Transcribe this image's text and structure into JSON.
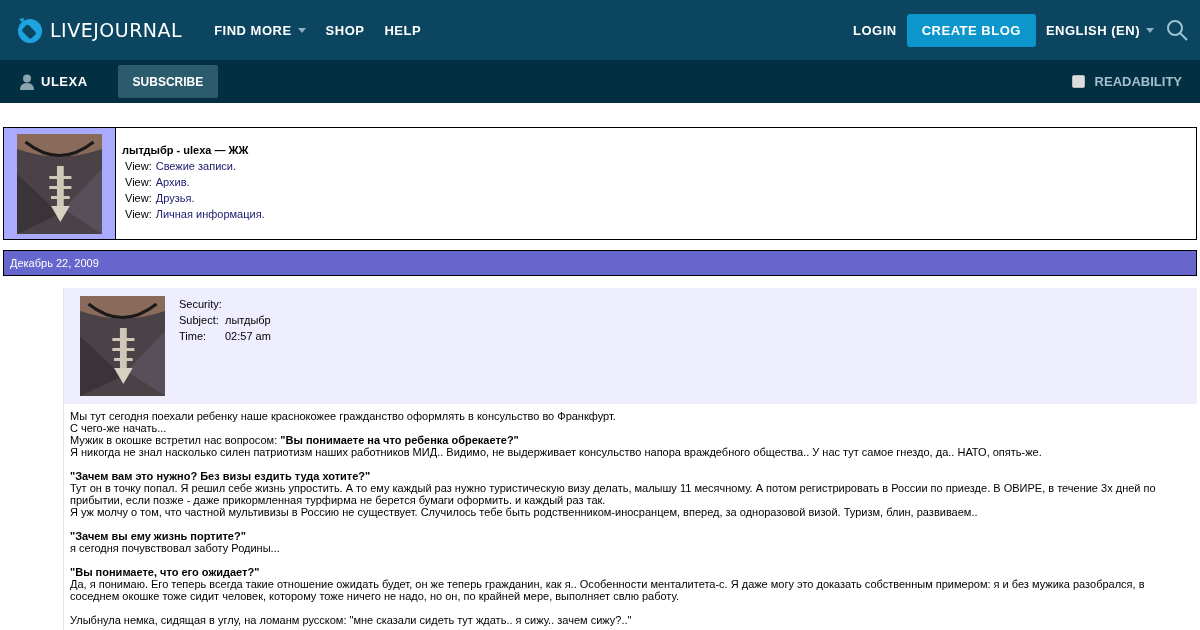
{
  "header": {
    "logo": "LIVEJOURNAL",
    "nav": [
      {
        "label": "FIND MORE",
        "dropdown": true
      },
      {
        "label": "SHOP",
        "dropdown": false
      },
      {
        "label": "HELP",
        "dropdown": false
      }
    ],
    "login": "LOGIN",
    "create_blog": "CREATE BLOG",
    "language": "ENGLISH (EN)"
  },
  "subbar": {
    "username": "ULEXA",
    "subscribe": "SUBSCRIBE",
    "readability": {
      "label": "READABILITY",
      "checked": false
    }
  },
  "profile": {
    "title": "лытдыбр - ulexa — ЖЖ",
    "links": [
      {
        "prefix": "View:",
        "label": "Свежие записи."
      },
      {
        "prefix": "View:",
        "label": "Архив."
      },
      {
        "prefix": "View:",
        "label": "Друзья."
      },
      {
        "prefix": "View:",
        "label": "Личная информация."
      }
    ]
  },
  "date": "Декабрь 22, 2009",
  "post": {
    "meta": [
      {
        "label": "Security:"
      },
      {
        "label": "Subject:",
        "value": "лытдыбр"
      },
      {
        "label": "Time:",
        "value": "02:57 am"
      }
    ],
    "paragraphs": [
      [
        "Мы тут сегодня поехали ребенку наше краснокожее гражданство оформлять в консульство во Франкфурт.",
        "С чего-же начать...",
        "Мужик в окошке встретил нас вопросом: **\"Вы понимаете на что ребенка обрекаете?\"**",
        "Я никогда не знал насколько силен патриотизм наших работников МИД.. Видимо, не выдерживает консульство напора враждебного общества.. У нас тут самое гнездо, да.. НАТО, опять-же."
      ],
      [
        "**\"Зачем вам это нужно? Без визы ездить туда хотите?\"**",
        "Тут он в точку попал. Я решил себе жизнь упростить. А то ему каждый раз нужно туристическую визу делать, малышу 11 месячному. А потом регистрировать в России по приезде. В ОВИРЕ, в течение 3х дней по прибытии, если позже - даже прикормленная турфирма не берется бумаги оформить. и каждый раз так.",
        "Я уж молчу о том, что частной мультивизы в Россию не существует. Случилось тебе быть родственником-иносранцем, вперед, за одноразовой визой. Туризм, блин, развиваем.."
      ],
      [
        "**\"Зачем вы ему жизнь портите?\"**",
        "я сегодня почувствовал заботу Родины..."
      ],
      [
        "**\"Вы понимаете, что его ожидает?\"**",
        "Да, я понимаю. Его теперь всегда такие отношение ожидать будет, он же теперь гражданин, как я.. Особенности менталитета-с. Я даже могу это доказать собственным примером:  я и без мужика разобрался, в соседнем окошке тоже сидит человек, которому тоже ничего не надо, но он, по крайней мере, выполняет свлю работу."
      ],
      [
        "Улыбнула немка, сидящая в углу, на ломанм русском: \"мне сказали сидеть тут ждать.. я сижу.. зачем сижу?..\""
      ]
    ]
  }
}
